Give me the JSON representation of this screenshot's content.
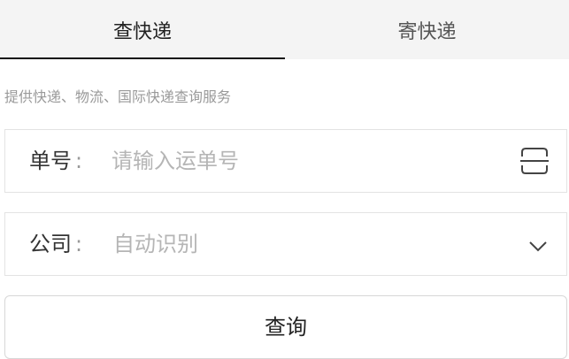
{
  "tabs": [
    {
      "label": "查快递",
      "active": true
    },
    {
      "label": "寄快递",
      "active": false
    }
  ],
  "description": "提供快递、物流、国际快递查询服务",
  "tracking_field": {
    "label": "单号",
    "colon": ":",
    "placeholder": "请输入运单号",
    "value": "",
    "icon": "scan-icon"
  },
  "company_field": {
    "label": "公司",
    "colon": ":",
    "selected": "自动识别",
    "icon": "chevron-down-icon"
  },
  "query_button": {
    "label": "查询"
  },
  "colors": {
    "tab_bar_bg": "#f4f4f4",
    "active_underline": "#111111",
    "placeholder": "#b5b5b5",
    "description": "#9a9a9a",
    "border": "#e3e3e3"
  }
}
